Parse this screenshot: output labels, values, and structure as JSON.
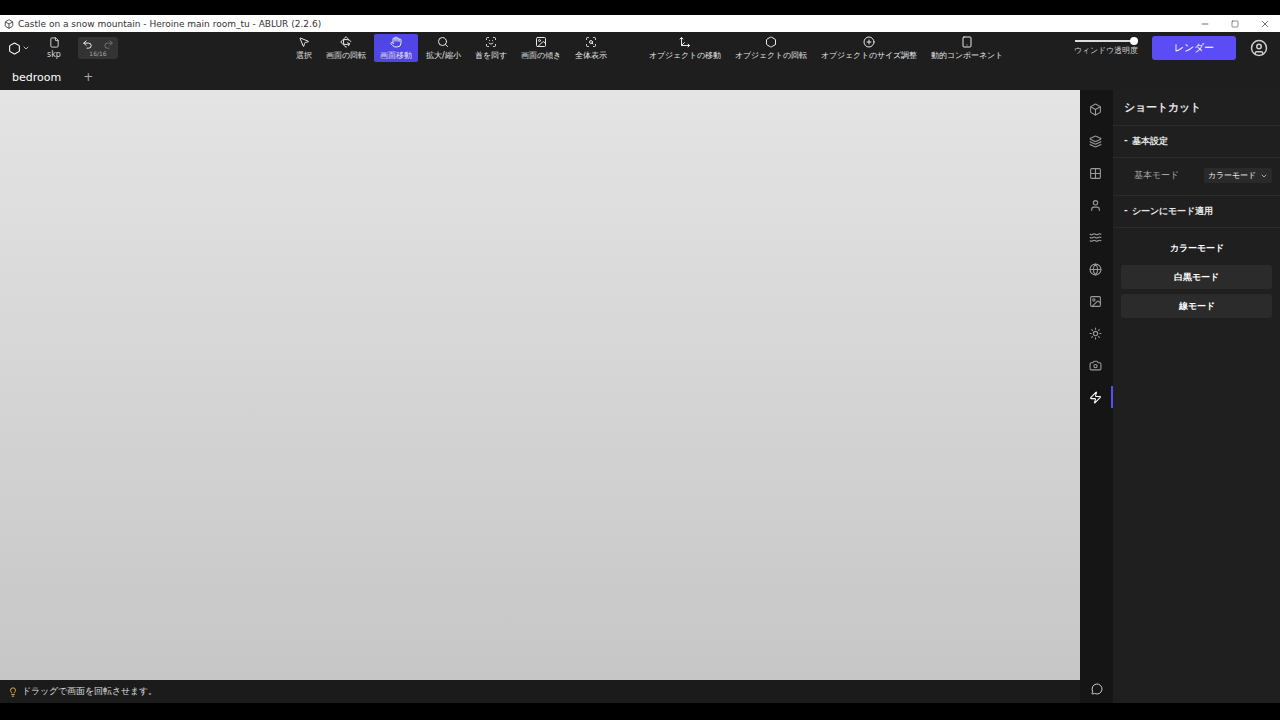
{
  "window": {
    "title": "Castle on a snow mountain - Heroine main room_tu - ABLUR (2.2.6)"
  },
  "toolbar": {
    "file": {
      "label": "skp"
    },
    "undo_count": "16/16",
    "tools": [
      {
        "label": "選択",
        "selected": false
      },
      {
        "label": "画面の回転",
        "selected": false
      },
      {
        "label": "画面移動",
        "selected": true
      },
      {
        "label": "拡大/縮小",
        "selected": false
      },
      {
        "label": "首を回す",
        "selected": false
      },
      {
        "label": "画面の傾き",
        "selected": false
      },
      {
        "label": "全体表示",
        "selected": false
      },
      {
        "label": "オブジェクトの移動",
        "selected": false
      },
      {
        "label": "オブジェクトの回転",
        "selected": false
      },
      {
        "label": "オブジェクトのサイズ調整",
        "selected": false
      },
      {
        "label": "動的コンポーネント",
        "selected": false
      }
    ],
    "transparency": {
      "label": "ウィンドウ透明度",
      "level": 0.95
    },
    "render_button": "レンダー"
  },
  "tabs": [
    {
      "label": "bedroom",
      "selected": true
    }
  ],
  "add_tab": "+",
  "side_strip": [
    {
      "selected": false
    },
    {
      "selected": false
    },
    {
      "selected": false
    },
    {
      "selected": false
    },
    {
      "selected": false
    },
    {
      "selected": false
    },
    {
      "selected": false
    },
    {
      "selected": false
    },
    {
      "selected": false
    },
    {
      "selected": true
    }
  ],
  "panel": {
    "title": "ショートカット",
    "basic": {
      "toggle": "-",
      "title": "基本設定",
      "label": "基本モード",
      "value": "カラーモード"
    },
    "apply": {
      "toggle": "-",
      "title": "シーンにモード適用",
      "buttons": [
        {
          "label": "カラーモード",
          "hovered": true
        },
        {
          "label": "白黒モード",
          "hovered": false
        },
        {
          "label": "線モード",
          "hovered": false
        }
      ]
    }
  },
  "status": {
    "hint": "ドラッグで画面を回転させます。"
  }
}
